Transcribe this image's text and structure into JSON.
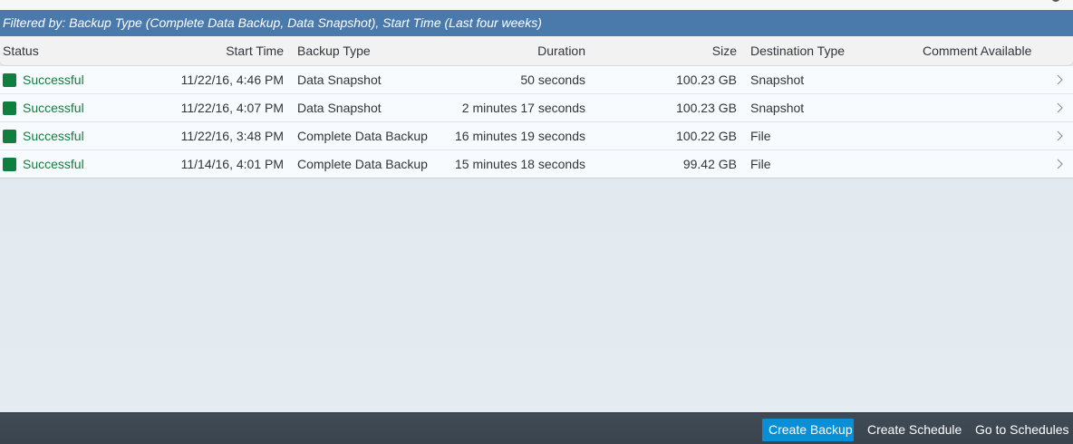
{
  "filter_bar": {
    "text": "Filtered by: Backup Type (Complete Data Backup, Data Snapshot), Start Time (Last four weeks)"
  },
  "table": {
    "columns": {
      "status": "Status",
      "start_time": "Start Time",
      "backup_type": "Backup Type",
      "duration": "Duration",
      "size": "Size",
      "destination_type": "Destination Type",
      "comment_available": "Comment Available"
    },
    "rows": [
      {
        "status": "Successful",
        "start_time": "11/22/16, 4:46 PM",
        "backup_type": "Data Snapshot",
        "duration": "50 seconds",
        "size": "100.23 GB",
        "destination_type": "Snapshot",
        "comment_available": ""
      },
      {
        "status": "Successful",
        "start_time": "11/22/16, 4:07 PM",
        "backup_type": "Data Snapshot",
        "duration": "2 minutes 17 seconds",
        "size": "100.23 GB",
        "destination_type": "Snapshot",
        "comment_available": ""
      },
      {
        "status": "Successful",
        "start_time": "11/22/16, 3:48 PM",
        "backup_type": "Complete Data Backup",
        "duration": "16 minutes 19 seconds",
        "size": "100.22 GB",
        "destination_type": "File",
        "comment_available": ""
      },
      {
        "status": "Successful",
        "start_time": "11/14/16, 4:01 PM",
        "backup_type": "Complete Data Backup",
        "duration": "15 minutes 18 seconds",
        "size": "99.42 GB",
        "destination_type": "File",
        "comment_available": ""
      }
    ]
  },
  "footer": {
    "create_backup": "Create Backup",
    "create_schedule": "Create Schedule",
    "go_to_schedules": "Go to Schedules"
  },
  "icons": {
    "status": "status-success-square-icon",
    "row_nav": "chevron-right-icon",
    "top_right": [
      "help-icon",
      "settings-gear-icon"
    ]
  },
  "colors": {
    "filter_bar_bg": "#4a7aab",
    "success": "#107e3e",
    "primary_button": "#0a8fd6",
    "footer_bg": "#3e4852"
  }
}
